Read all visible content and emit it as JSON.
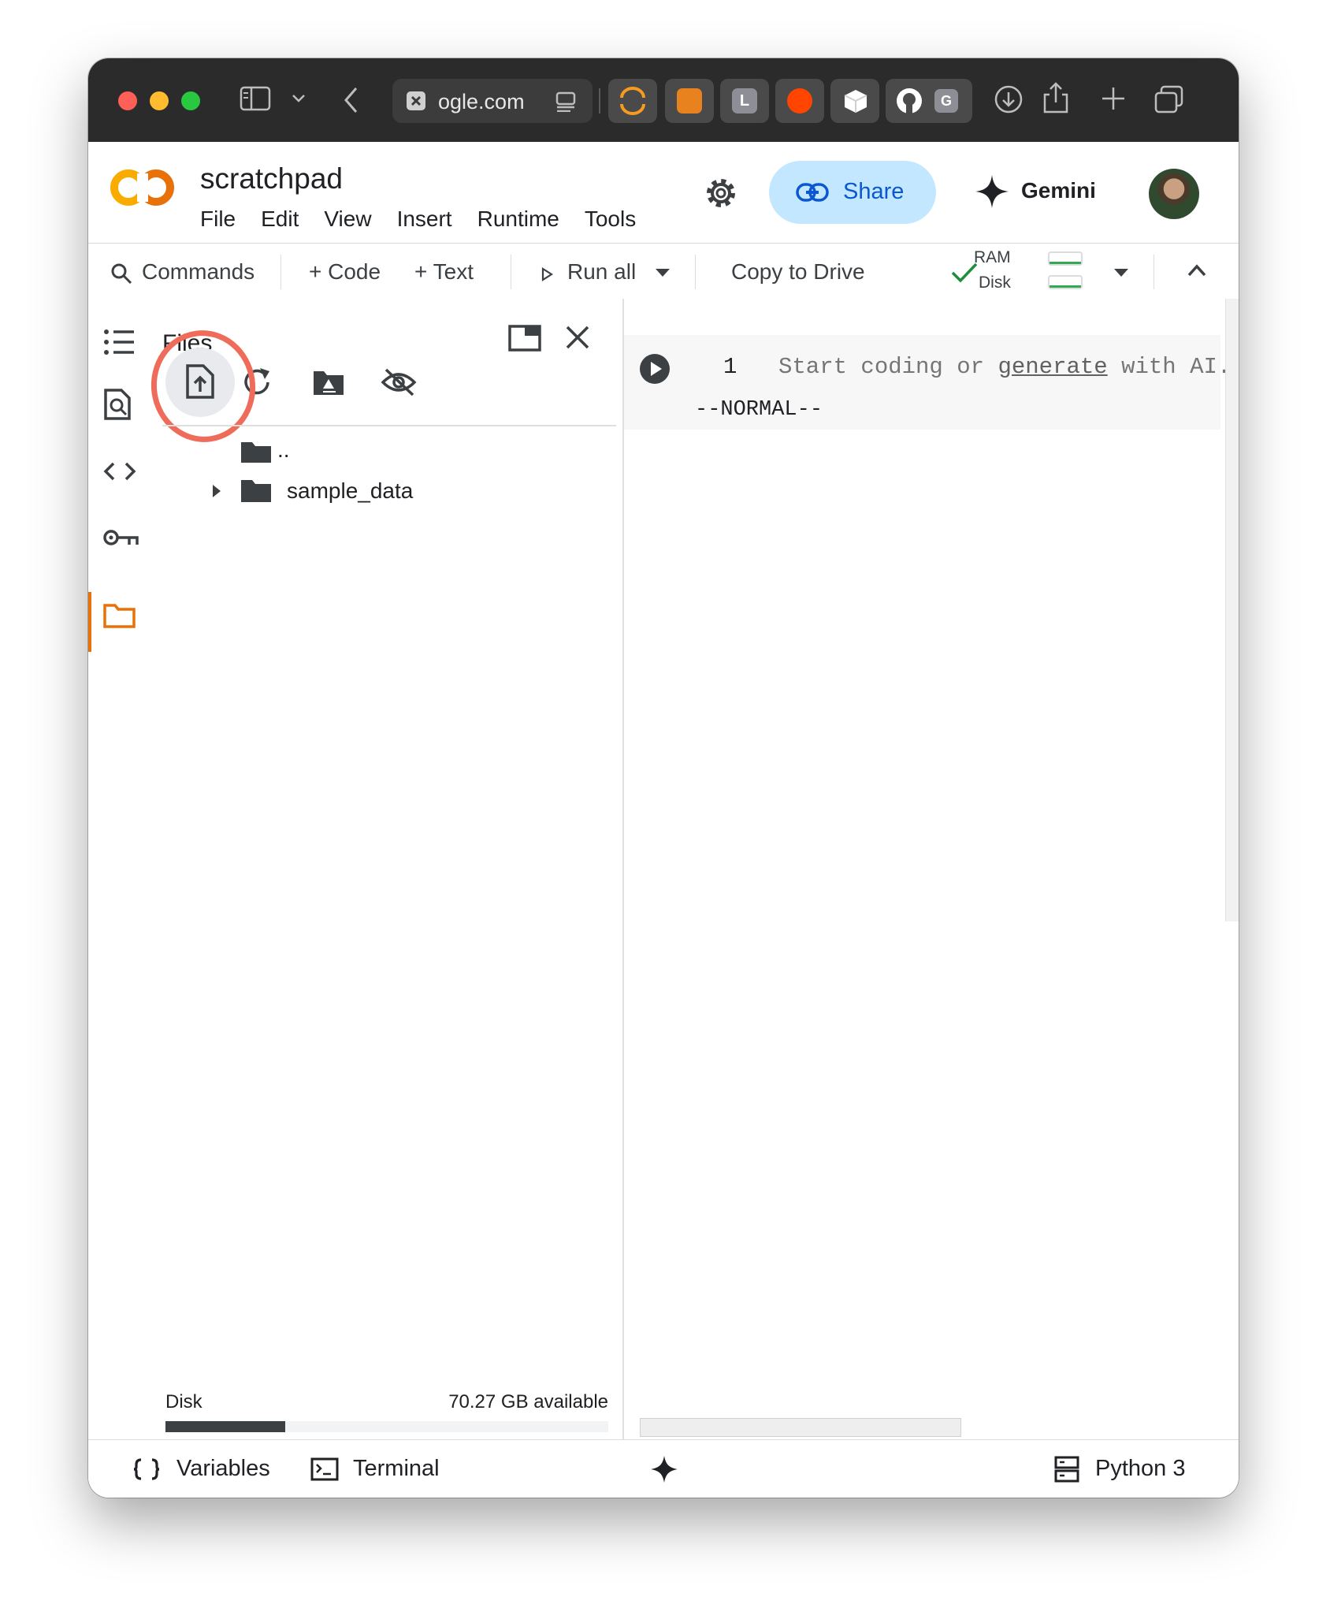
{
  "browser": {
    "url_text": "ogle.com",
    "tab_letters": {
      "l_tab": "L",
      "g_tab": "G"
    }
  },
  "header": {
    "notebook_title": "scratchpad",
    "menus": [
      "File",
      "Edit",
      "View",
      "Insert",
      "Runtime",
      "Tools"
    ],
    "share_label": "Share",
    "gemini_label": "Gemini"
  },
  "toolbar": {
    "commands_label": "Commands",
    "code_label": "+ Code",
    "text_label": "+ Text",
    "run_all_label": "Run all",
    "copy_to_drive_label": "Copy to Drive",
    "ram_label": "RAM",
    "disk_label": "Disk"
  },
  "files_panel": {
    "title": "Files",
    "parent_dir": "..",
    "folder_name": "sample_data",
    "disk_label": "Disk",
    "disk_available": "70.27 GB available",
    "disk_used_fraction": 0.27
  },
  "editor": {
    "line_number": "1",
    "placeholder_prefix": "Start coding or ",
    "placeholder_link": "generate",
    "placeholder_suffix": " with AI.",
    "vim_mode": "--NORMAL--"
  },
  "statusbar": {
    "variables_label": "Variables",
    "terminal_label": "Terminal",
    "runtime_label": "Python 3"
  },
  "colors": {
    "accent_orange": "#e8710a",
    "share_bg": "#c2e7ff",
    "share_text": "#0b57d0",
    "annotation_red": "#ef6b5a",
    "ok_green": "#34a853"
  },
  "icons": [
    "sidebar-icon",
    "back-icon",
    "close-tab-icon",
    "reader-icon",
    "download-icon",
    "share-icon",
    "new-tab-icon",
    "tabs-overview-icon",
    "settings-gear-icon",
    "link-icon",
    "sparkle-icon",
    "search-icon",
    "play-icon",
    "dropdown-icon",
    "check-icon",
    "chevron-up-icon",
    "toc-icon",
    "find-icon",
    "code-icon",
    "key-icon",
    "folder-icon",
    "new-window-icon",
    "close-icon",
    "upload-file-icon",
    "refresh-icon",
    "drive-icon",
    "hidden-icon",
    "triangle-right-icon",
    "braces-icon",
    "terminal-icon",
    "server-icon"
  ]
}
